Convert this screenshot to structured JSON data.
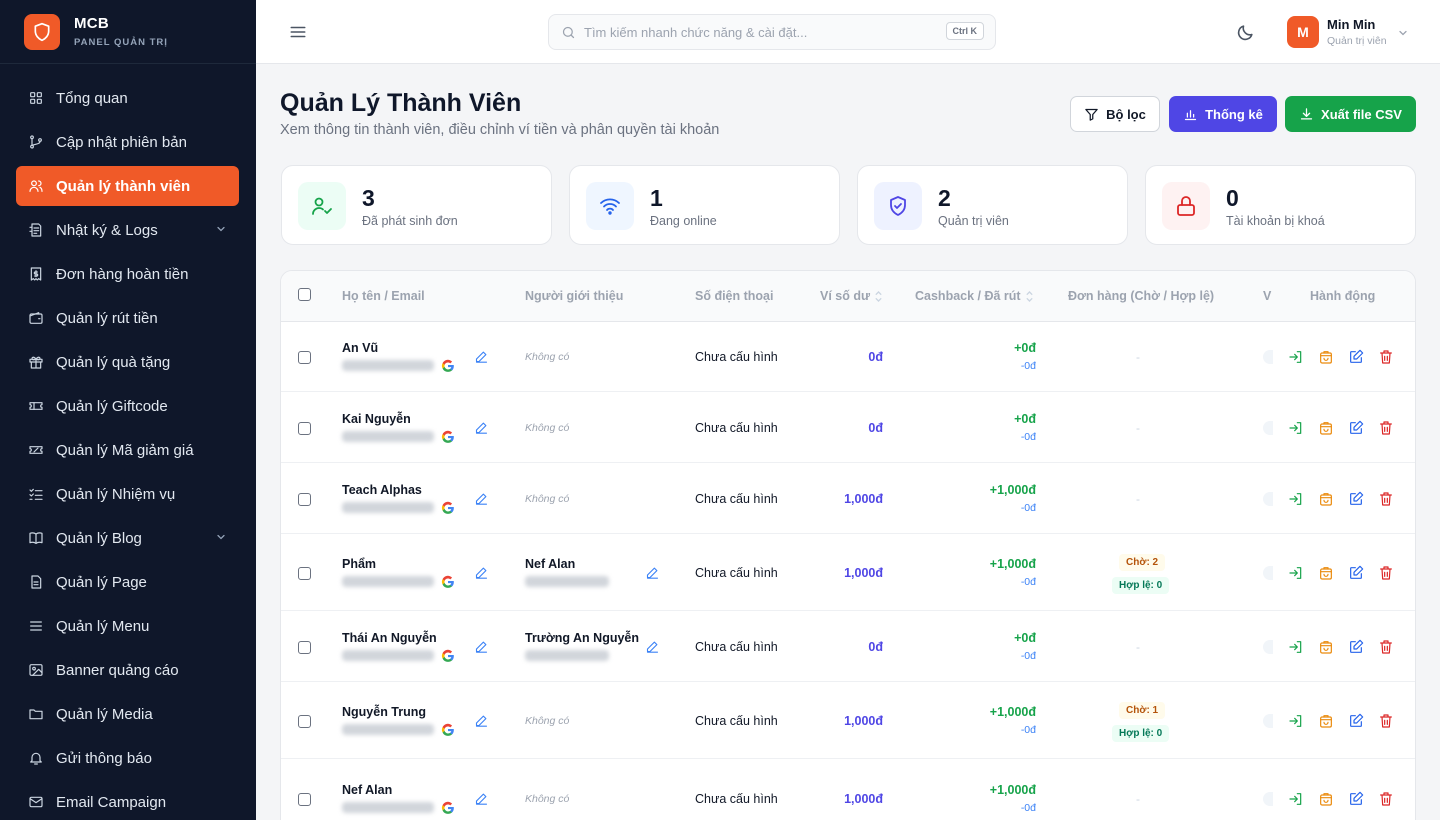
{
  "brand": {
    "name": "MCB",
    "subtitle": "PANEL QUẢN TRỊ"
  },
  "sidebar": {
    "items": [
      {
        "label": "Tổng quan",
        "icon": "grid-icon"
      },
      {
        "label": "Cập nhật phiên bản",
        "icon": "git-branch-icon"
      },
      {
        "label": "Quản lý thành viên",
        "icon": "users-icon",
        "active": true
      },
      {
        "label": "Nhật ký & Logs",
        "icon": "log-icon",
        "has_submenu": true
      },
      {
        "label": "Đơn hàng hoàn tiền",
        "icon": "receipt-icon"
      },
      {
        "label": "Quản lý rút tiền",
        "icon": "wallet-icon"
      },
      {
        "label": "Quản lý quà tặng",
        "icon": "gift-icon"
      },
      {
        "label": "Quản lý Giftcode",
        "icon": "ticket-icon"
      },
      {
        "label": "Quản lý Mã giảm giá",
        "icon": "coupon-icon"
      },
      {
        "label": "Quản lý Nhiệm vụ",
        "icon": "task-list-icon"
      },
      {
        "label": "Quản lý Blog",
        "icon": "book-icon",
        "has_submenu": true
      },
      {
        "label": "Quản lý Page",
        "icon": "file-icon"
      },
      {
        "label": "Quản lý Menu",
        "icon": "menu-icon"
      },
      {
        "label": "Banner quảng cáo",
        "icon": "image-icon"
      },
      {
        "label": "Quản lý Media",
        "icon": "folder-icon"
      },
      {
        "label": "Gửi thông báo",
        "icon": "bell-icon"
      },
      {
        "label": "Email Campaign",
        "icon": "mail-icon"
      }
    ]
  },
  "search": {
    "placeholder": "Tìm kiếm nhanh chức năng & cài đặt...",
    "shortcut": "Ctrl K"
  },
  "user": {
    "initial": "M",
    "name": "Min Min",
    "role": "Quản trị viên"
  },
  "page": {
    "title": "Quản Lý Thành Viên",
    "subtitle": "Xem thông tin thành viên, điều chỉnh ví tiền và phân quyền tài khoản"
  },
  "actions": {
    "filter": "Bộ lọc",
    "stats": "Thống kê",
    "export": "Xuất file CSV"
  },
  "stats": [
    {
      "value": "3",
      "label": "Đã phát sinh đơn",
      "icon": "user-check-icon",
      "color": "#16a34a",
      "bg": "#ecfdf5"
    },
    {
      "value": "1",
      "label": "Đang online",
      "icon": "wifi-icon",
      "color": "#2563eb",
      "bg": "#eff6ff"
    },
    {
      "value": "2",
      "label": "Quản trị viên",
      "icon": "shield-check-icon",
      "color": "#4f46e5",
      "bg": "#eef2ff"
    },
    {
      "value": "0",
      "label": "Tài khoản bị khoá",
      "icon": "lock-icon",
      "color": "#dc2626",
      "bg": "#fef2f2"
    }
  ],
  "table": {
    "headers": {
      "name": "Họ tên / Email",
      "referrer": "Người giới thiệu",
      "phone": "Số điện thoại",
      "wallet": "Ví số dư",
      "cashback": "Cashback / Đã rút",
      "orders": "Đơn hàng (Chờ / Hợp lệ)",
      "v": "V",
      "actions": "Hành động"
    },
    "rows": [
      {
        "name": "An Vũ",
        "referrer": "Không có",
        "phone": "Chưa cấu hình",
        "wallet": "0đ",
        "cashback": "+0đ",
        "withdrawn": "-0đ",
        "orders": "-"
      },
      {
        "name": "Kai Nguyễn",
        "referrer": "Không có",
        "phone": "Chưa cấu hình",
        "wallet": "0đ",
        "cashback": "+0đ",
        "withdrawn": "-0đ",
        "orders": "-"
      },
      {
        "name": "Teach Alphas",
        "referrer": "Không có",
        "phone": "Chưa cấu hình",
        "wallet": "1,000đ",
        "cashback": "+1,000đ",
        "withdrawn": "-0đ",
        "orders": "-"
      },
      {
        "name": "Phẩm",
        "referrer": "Nef Alan",
        "phone": "Chưa cấu hình",
        "wallet": "1,000đ",
        "cashback": "+1,000đ",
        "withdrawn": "-0đ",
        "pending": "Chờ: 2",
        "valid": "Hợp lệ: 0"
      },
      {
        "name": "Thái An Nguyễn",
        "referrer": "Trường An Nguyễn",
        "phone": "Chưa cấu hình",
        "wallet": "0đ",
        "cashback": "+0đ",
        "withdrawn": "-0đ",
        "orders": "-"
      },
      {
        "name": "Nguyễn Trung",
        "referrer": "Không có",
        "phone": "Chưa cấu hình",
        "wallet": "1,000đ",
        "cashback": "+1,000đ",
        "withdrawn": "-0đ",
        "pending": "Chờ: 1",
        "valid": "Hợp lệ: 0"
      },
      {
        "name": "Nef Alan",
        "referrer": "Không có",
        "phone": "Chưa cấu hình",
        "wallet": "1,000đ",
        "cashback": "+1,000đ",
        "withdrawn": "-0đ",
        "orders": "-"
      }
    ]
  },
  "colors": {
    "brand": "#f05a28",
    "sidebar": "#0f172a",
    "accent": "#4f46e5",
    "success": "#16a34a"
  }
}
